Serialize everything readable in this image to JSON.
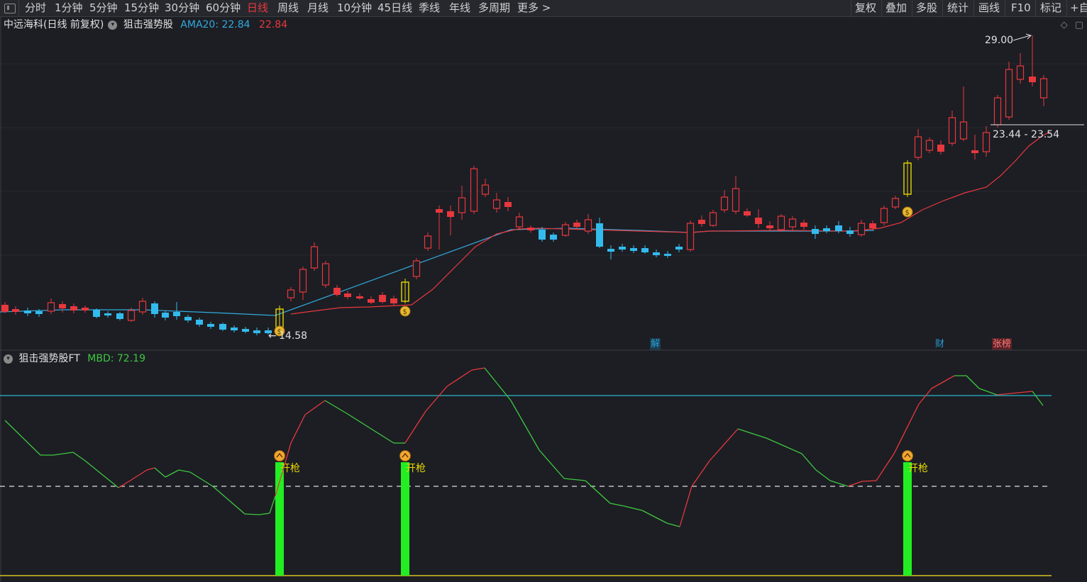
{
  "toolbar": {
    "periods": [
      "分时",
      "1分钟",
      "5分钟",
      "15分钟",
      "30分钟",
      "60分钟",
      "日线",
      "周线",
      "月线",
      "10分钟",
      "45日线",
      "季线",
      "年线",
      "多周期",
      "更多 >"
    ],
    "active_period": "日线",
    "right_buttons": [
      "复权",
      "叠加",
      "多股",
      "统计",
      "画线",
      "F10",
      "标记",
      "+自"
    ]
  },
  "main_panel": {
    "title": "中远海科(日线 前复权)",
    "indicator": "狙击强势股",
    "ama_label": "AMA20: 22.84",
    "ama_value2": "22.84",
    "high_label": "29.00",
    "low_label": "14.58",
    "range_label": "23.44 - 23.54"
  },
  "sub_panel": {
    "indicator": "狙击强势股FT",
    "mbd_label": "MBD: 72.19",
    "signal_text": "开枪"
  },
  "event_tags": [
    {
      "text": "解",
      "color": "#2a9fd6"
    },
    {
      "text": "财",
      "color": "#2a9fd6"
    },
    {
      "text": "张榜",
      "color": "#e8383d"
    }
  ],
  "colors": {
    "up": "#e8383d",
    "down": "#33bbee",
    "ama": "#e8383d",
    "flat_line": "#33aadd",
    "osc_up": "#e8383d",
    "osc_down": "#3ec83e",
    "signal_bar": "#22ee22",
    "cyan_level": "#2ab8c8",
    "baseline": "#d8c020"
  }
}
